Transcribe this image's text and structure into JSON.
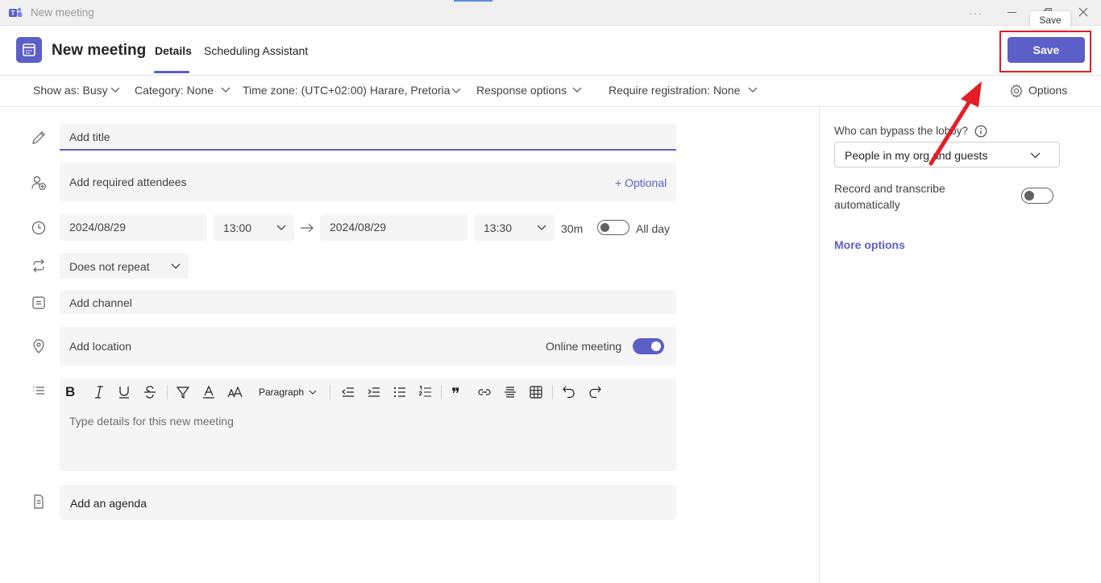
{
  "window": {
    "app_title": "New meeting",
    "tooltip": "Save"
  },
  "header": {
    "title": "New meeting",
    "tabs": [
      {
        "label": "Details",
        "active": true
      },
      {
        "label": "Scheduling Assistant",
        "active": false
      }
    ],
    "save_label": "Save"
  },
  "options_bar": {
    "show_as": "Show as: Busy",
    "category": "Category: None",
    "time_zone": "Time zone: (UTC+02:00) Harare, Pretoria",
    "response_options": "Response options",
    "require_registration": "Require registration: None",
    "options_label": "Options"
  },
  "form": {
    "title_placeholder": "Add title",
    "attendees_placeholder": "Add required attendees",
    "optional_label": "+ Optional",
    "start_date": "2024/08/29",
    "start_time": "13:00",
    "end_date": "2024/08/29",
    "end_time": "13:30",
    "duration": "30m",
    "all_day_label": "All day",
    "all_day_on": false,
    "repeat": "Does not repeat",
    "channel_placeholder": "Add channel",
    "location_placeholder": "Add location",
    "online_meeting_label": "Online meeting",
    "online_meeting_on": true,
    "details_placeholder": "Type details for this new meeting",
    "paragraph_label": "Paragraph",
    "agenda_placeholder": "Add an agenda"
  },
  "side_panel": {
    "lobby_label": "Who can bypass the lobby?",
    "lobby_value": "People in my org and guests",
    "record_label_line1": "Record and transcribe",
    "record_label_line2": "automatically",
    "record_on": false,
    "more_options": "More options"
  },
  "colors": {
    "accent": "#5b5fc7",
    "annotation_red": "#e31e24"
  },
  "icons": {
    "title": "pencil-icon",
    "attendees": "person-add-icon",
    "time": "clock-icon",
    "repeat": "repeat-icon",
    "channel": "channel-icon",
    "location": "location-pin-icon",
    "details": "list-icon",
    "agenda": "agenda-note-icon"
  }
}
